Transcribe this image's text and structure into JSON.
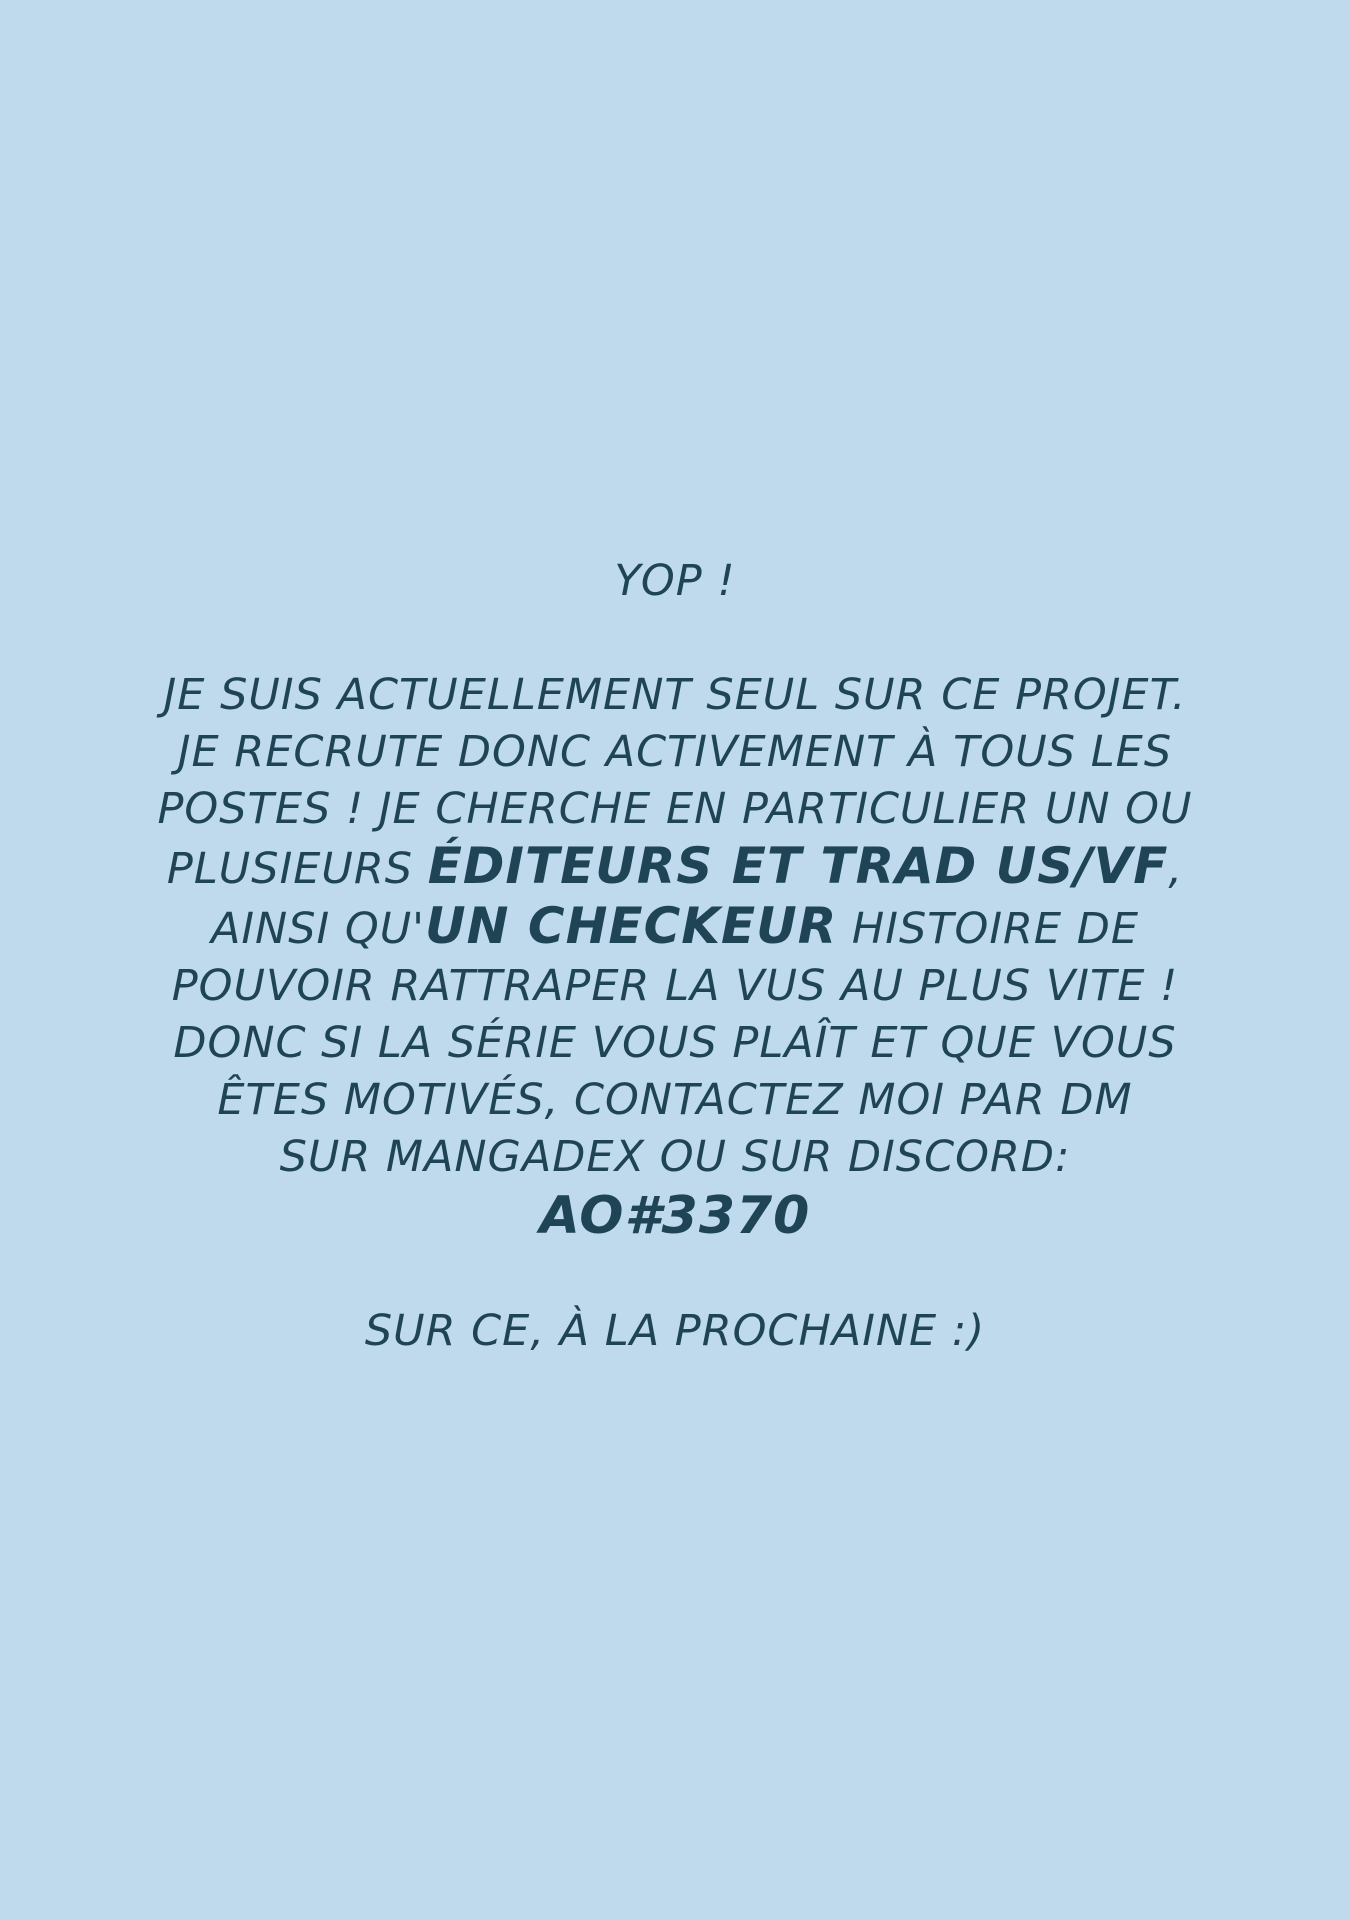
{
  "theme": {
    "background": "#BEDAEC",
    "text": "#1F4455"
  },
  "message": {
    "greeting": "YOP !",
    "line1": "JE SUIS ACTUELLEMENT SEUL SUR CE PROJET.",
    "line2": "JE RECRUTE DONC ACTIVEMENT À TOUS LES",
    "line3": "POSTES ! JE CHERCHE EN PARTICULIER UN OU",
    "line4_prefix": "PLUSIEURS ",
    "line4_emphasis": "ÉDITEURS ET TRAD US/VF",
    "line4_suffix": ",",
    "line5_prefix": "AINSI QU'",
    "line5_emphasis": "UN CHECKEUR",
    "line5_suffix": " HISTOIRE DE",
    "line6": "POUVOIR RATTRAPER LA VUS AU PLUS VITE !",
    "line7": "DONC SI LA SÉRIE VOUS PLAÎT ET QUE VOUS",
    "line8": "ÊTES MOTIVÉS, CONTACTEZ MOI PAR DM",
    "line9": "SUR MANGADEX OU SUR DISCORD:",
    "contact_handle": "AO#3370",
    "closing": "SUR CE, À LA PROCHAINE :)"
  }
}
